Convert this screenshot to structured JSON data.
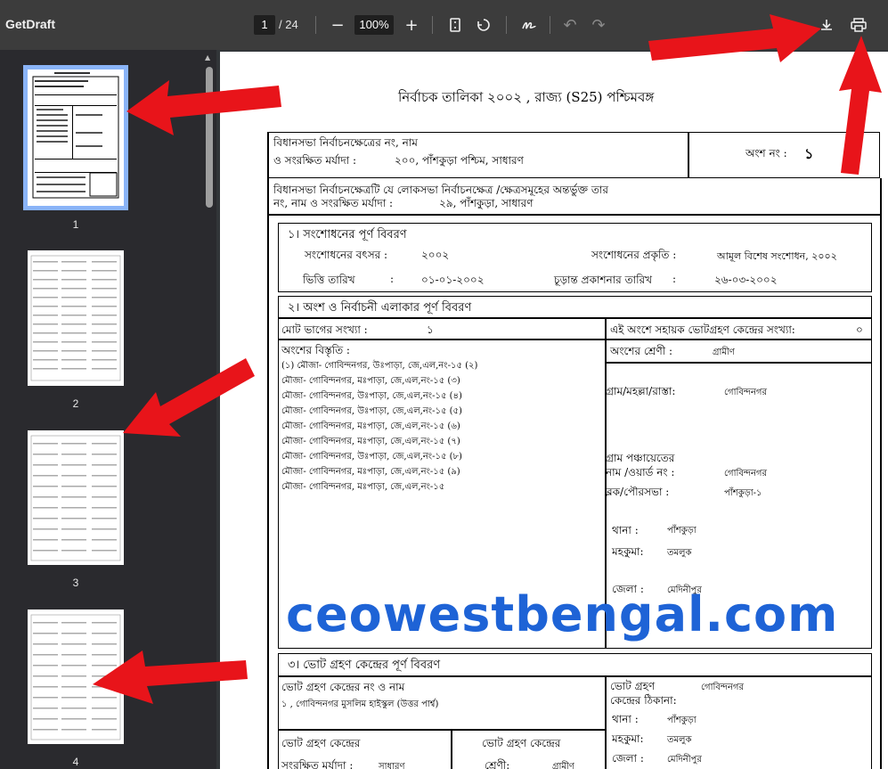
{
  "app": {
    "title": "GetDraft",
    "current_page": "1",
    "total_pages": "/ 24",
    "zoom": "100%",
    "icons": {
      "zoom_out": "minus-icon",
      "zoom_in": "plus-icon",
      "fit": "fit-page-icon",
      "rotate": "rotate-icon",
      "annotate": "pen-icon",
      "undo": "undo-icon",
      "redo": "redo-icon",
      "download": "download-icon",
      "print": "print-icon"
    }
  },
  "sidebar": {
    "thumbnails": [
      {
        "label": "1"
      },
      {
        "label": "2"
      },
      {
        "label": "3"
      },
      {
        "label": "4"
      }
    ]
  },
  "document": {
    "heading": "নির্বাচক তালিকা   ২০০২ , রাজ্য (S25) পশ্চিমবঙ্গ",
    "assembly_label_1": "বিধানসভা নির্বাচনক্ষেত্রের নং, নাম",
    "assembly_label_2": "ও সংরক্ষিত মর্যাদা :",
    "assembly_value": "২০০, পাঁশকুড়া পশ্চিম,  সাধারণ",
    "part_label": "অংশ নং :",
    "part_value": "১",
    "parliament_label_1": "বিধানসভা নির্বাচনক্ষেত্রটি যে লোকসভা নির্বাচনক্ষেত্র /ক্ষেত্রসমূহের অন্তর্ভুক্ত তার",
    "parliament_label_2": "নং, নাম  ও সংরক্ষিত মর্যাদা :",
    "parliament_value": "২৯,  পাঁশকুড়া,  সাধারণ",
    "s1": {
      "title": "১। সংশোধনের পূর্ণ বিবরণ",
      "year_label": "সংশোধনের বৎসর :",
      "year_value": "২০০২",
      "nature_label": "সংশোধনের প্রকৃতি :",
      "nature_value": "আমূল বিশেষ সংশোধন, ২০০২",
      "base_date_label": "ভিত্তি তারিখ",
      "base_date_sep": ":",
      "base_date_value": "০১-০১-২০০২",
      "final_pub_label": "চূড়ান্ত প্রকাশনার তারিখ",
      "final_pub_sep": ":",
      "final_pub_value": "২৬-০৩-২০০২"
    },
    "s2": {
      "title": "২। অংশ ও নির্বাচনী এলাকার পূর্ণ বিবরণ",
      "sections_label": "মোট ভাগের সংখ্যা :",
      "sections_value": "১",
      "aux_label": "এই অংশে সহায়ক ভোটগ্রহণ কেন্দ্রের সংখ্যা:",
      "aux_value": "০",
      "extent_label": "অংশের বিস্তৃতি  :",
      "extent_items": [
        "(১) মৌজা- গোবিন্দনগর, উঃপাড়া, জে,এল,নং-১৫  (২)",
        "মৌজা- গোবিন্দনগর, মঃপাড়া, জে,এল,নং-১৫  (৩)",
        "মৌজা- গোবিন্দনগর, উঃপাড়া, জে,এল,নং-১৫  (৪)",
        "মৌজা- গোবিন্দনগর, উঃপাড়া, জে,এল,নং-১৫  (৫)",
        "মৌজা- গোবিন্দনগর, মঃপাড়া, জে,এল,নং-১৫  (৬)",
        "মৌজা- গোবিন্দনগর, মঃপাড়া, জে,এল,নং-১৫  (৭)",
        "মৌজা- গোবিন্দনগর, উঃপাড়া, জে,এল,নং-১৫  (৮)",
        "মৌজা- গোবিন্দনগর, মঃপাড়া, জে,এল,নং-১৫  (৯)",
        "মৌজা- গোবিন্দনগর, মঃপাড়া, জে,এল,নং-১৫"
      ],
      "category_label": "অংশের শ্রেণী :",
      "category_value": "গ্রামীণ",
      "village_label": "গ্রাম/মহল্লা/রাস্তা:",
      "village_value": "গোবিন্দনগর",
      "gp_label_1": "গ্রাম পঞ্চায়েতের",
      "gp_label_2": "নাম /ওয়ার্ড নং  :",
      "gp_value": "গোবিন্দনগর",
      "block_label": "ব্লক/পৌরসভা  :",
      "block_value": "পাঁশকুড়া-১",
      "ps_label": "থানা  :",
      "ps_value": "পাঁশকুড়া",
      "subdiv_label": "মহকুমা:",
      "subdiv_value": "তমলুক",
      "district_label": "জেলা  :",
      "district_value": "মেদিনীপুর"
    },
    "s3": {
      "title": "৩। ভোট গ্রহণ কেন্দ্রের পূর্ণ বিবরণ",
      "booth_label": "ভোট গ্রহণ কেন্দ্রের নং ও নাম",
      "booth_value": "১ , গোবিন্দনগর মুসলিম হাইস্কুল (উত্তর পার্শ্ব)",
      "addr_label_1": "ভোট গ্রহণ",
      "addr_label_2": "কেন্দ্রের ঠিকানা:",
      "addr_value": "গোবিন্দনগর",
      "ps_label": "থানা  :",
      "ps_value": "পাঁশকুড়া",
      "subdiv_label": "মহকুমা:",
      "subdiv_value": "তমলুক",
      "district_label": "জেলা  :",
      "district_value": "মেদিনীপুর",
      "reserved_label_1": "ভোট গ্রহণ কেন্দ্রের",
      "reserved_label_2": "সংরক্ষিত মর্যাদা :",
      "reserved_value": "সাধারণ",
      "type_label_1": "ভোট গ্রহণ কেন্দ্রের",
      "type_label_2": "শ্রেণী:",
      "type_value": "গ্রামীণ"
    },
    "watermark": "ceowestbengal.com"
  },
  "colors": {
    "toolbar": "#3c3c3c",
    "sidebar": "#2a2a2e",
    "thumb_highlight": "#8ab4f8",
    "watermark": "#1e63d6",
    "arrow": "#e8141a"
  }
}
